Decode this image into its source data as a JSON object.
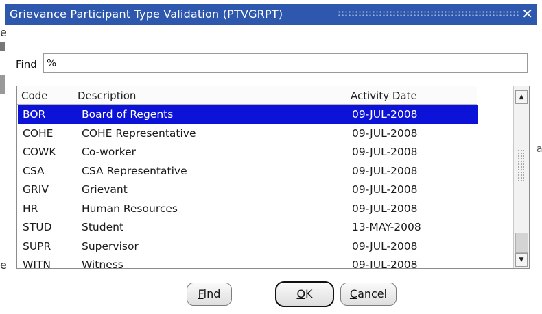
{
  "window": {
    "title": "Grievance Participant Type Validation (PTVGRPT)",
    "close_symbol": "✕"
  },
  "find": {
    "label": "Find",
    "value": "%"
  },
  "list": {
    "columns": [
      "Code",
      "Description",
      "Activity Date"
    ],
    "selected_index": 0,
    "rows": [
      {
        "code": "BOR",
        "description": "Board of Regents",
        "date": "09-JUL-2008"
      },
      {
        "code": "COHE",
        "description": "COHE Representative",
        "date": "09-JUL-2008"
      },
      {
        "code": "COWK",
        "description": "Co-worker",
        "date": "09-JUL-2008"
      },
      {
        "code": "CSA",
        "description": "CSA Representative",
        "date": "09-JUL-2008"
      },
      {
        "code": "GRIV",
        "description": "Grievant",
        "date": "09-JUL-2008"
      },
      {
        "code": "HR",
        "description": "Human Resources",
        "date": "09-JUL-2008"
      },
      {
        "code": "STUD",
        "description": "Student",
        "date": "13-MAY-2008"
      },
      {
        "code": "SUPR",
        "description": "Supervisor",
        "date": "09-JUL-2008"
      },
      {
        "code": "WITN",
        "description": "Witness",
        "date": "09-JUL-2008"
      }
    ]
  },
  "buttons": {
    "find": {
      "key": "F",
      "rest": "ind"
    },
    "ok": {
      "key": "O",
      "rest": "K"
    },
    "cancel": {
      "key": "C",
      "rest": "ancel"
    }
  },
  "icons": {
    "scroll_up": "scroll-up-arrow-icon",
    "scroll_down": "scroll-down-arrow-icon",
    "close": "close-icon"
  },
  "colors": {
    "title_bar": "#2d58ad",
    "selection": "#0c12d8"
  }
}
